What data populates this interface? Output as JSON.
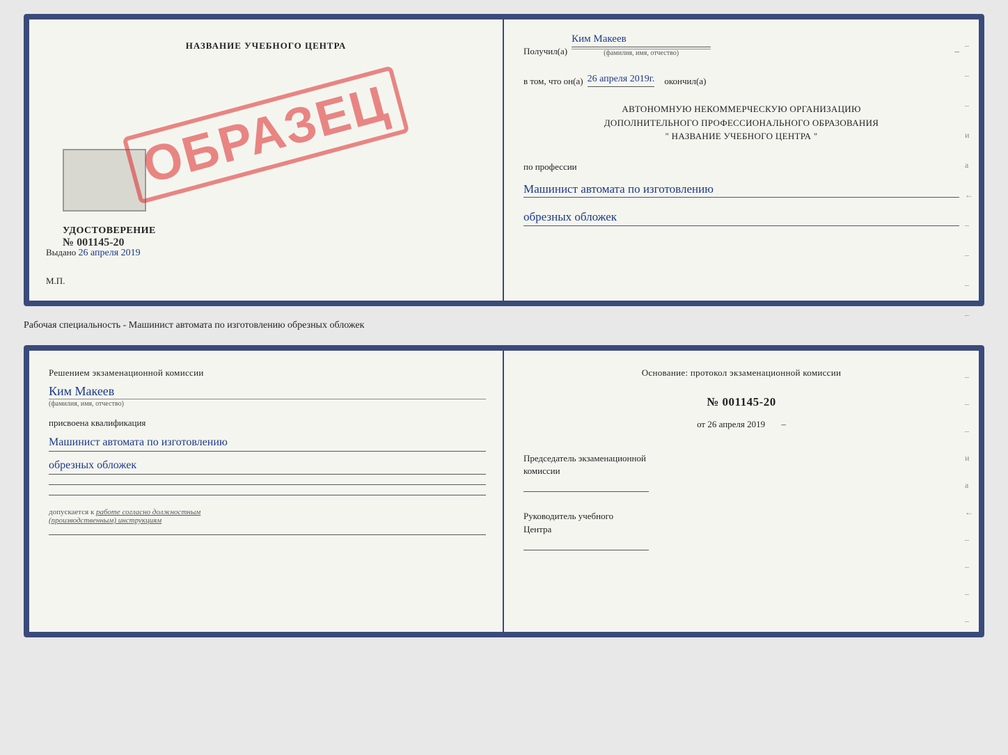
{
  "doc1": {
    "left": {
      "title": "НАЗВАНИЕ УЧЕБНОГО ЦЕНТРА",
      "stamp": "ОБРАЗЕЦ",
      "cert_type": "УДОСТОВЕРЕНИЕ",
      "cert_number": "№ 001145-20",
      "issued_label": "Выдано",
      "issued_date": "26 апреля 2019",
      "mp_label": "М.П."
    },
    "right": {
      "received_label": "Получил(а)",
      "recipient_name": "Ким Макеев",
      "recipient_sublabel": "(фамилия, имя, отчество)",
      "in_that_label": "в том, что он(а)",
      "completion_date": "26 апреля 2019г.",
      "finished_label": "окончил(а)",
      "org_line1": "АВТОНОМНУЮ НЕКОММЕРЧЕСКУЮ ОРГАНИЗАЦИЮ",
      "org_line2": "ДОПОЛНИТЕЛЬНОГО ПРОФЕССИОНАЛЬНОГО ОБРАЗОВАНИЯ",
      "org_line3": "\"  НАЗВАНИЕ УЧЕБНОГО ЦЕНТРА  \"",
      "profession_label": "по профессии",
      "profession_line1": "Машинист автомата по изготовлению",
      "profession_line2": "обрезных обложек",
      "dash1": "–",
      "dash2": "–",
      "dash3": "–",
      "dash4": "и",
      "dash5": "а",
      "dash6": "←",
      "dash7": "–",
      "dash8": "–",
      "dash9": "–",
      "dash10": "–"
    }
  },
  "between_label": "Рабочая специальность - Машинист автомата по изготовлению обрезных обложек",
  "doc2": {
    "left": {
      "commission_text": "Решением экзаменационной комиссии",
      "name": "Ким Макеев",
      "name_sublabel": "(фамилия, имя, отчество)",
      "qualification_label": "присвоена квалификация",
      "qualification_line1": "Машинист автомата по изготовлению",
      "qualification_line2": "обрезных обложек",
      "blank_line1": "",
      "blank_line2": "",
      "допуск_label": "допускается к",
      "допуск_text": "работе согласно должностным",
      "допуск_text2": "(производственным) инструкциям"
    },
    "right": {
      "foundation_text": "Основание: протокол экзаменационной комиссии",
      "protocol_number": "№ 001145-20",
      "date_label": "от",
      "date_value": "26 апреля 2019",
      "chairman_label": "Председатель экзаменационной",
      "chairman_label2": "комиссии",
      "director_label": "Руководитель учебного",
      "director_label2": "Центра",
      "dash1": "–",
      "dash2": "–",
      "dash3": "–",
      "dash4": "и",
      "dash5": "а",
      "dash6": "←",
      "dash7": "–",
      "dash8": "–",
      "dash9": "–",
      "dash10": "–"
    }
  }
}
